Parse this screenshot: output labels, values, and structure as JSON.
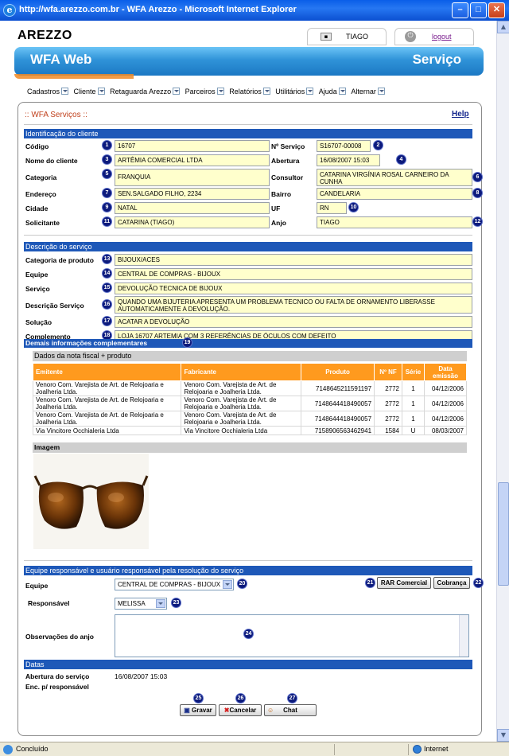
{
  "browser": {
    "title": "http://wfa.arezzo.com.br - WFA Arezzo - Microsoft Internet Explorer",
    "status_text": "Concluído",
    "zone": "Internet"
  },
  "header": {
    "logo": "AREZZO",
    "user": "TIAGO",
    "logout": "logout",
    "app_title": "WFA Web",
    "section_title": "Serviço"
  },
  "menu": [
    "Cadastros",
    "Cliente",
    "Retaguarda Arezzo",
    "Parceiros",
    "Relatórios",
    "Utilitários",
    "Ajuda",
    "Alternar"
  ],
  "page": {
    "title": ":: WFA Serviços ::",
    "help": "Help"
  },
  "client": {
    "section": "Identificação do cliente",
    "codigo_label": "Código",
    "codigo": "16707",
    "nservico_label": "Nº Serviço",
    "nservico": "S16707-00008",
    "nome_label": "Nome do cliente",
    "nome": "ARTÊMIA COMERCIAL LTDA",
    "abertura_label": "Abertura",
    "abertura": "16/08/2007 15:03",
    "categoria_label": "Categoria",
    "categoria": "FRANQUIA",
    "consultor_label": "Consultor",
    "consultor": "CATARINA VIRGÍNIA ROSAL CARNEIRO DA CUNHA",
    "endereco_label": "Endereço",
    "endereco": "SEN.SALGADO FILHO, 2234",
    "bairro_label": "Bairro",
    "bairro": "CANDELARIA",
    "cidade_label": "Cidade",
    "cidade": "NATAL",
    "uf_label": "UF",
    "uf": "RN",
    "solicitante_label": "Solicitante",
    "solicitante": "CATARINA (TIAGO)",
    "anjo_label": "Anjo",
    "anjo": "TIAGO"
  },
  "service": {
    "section": "Descrição do serviço",
    "categoria_label": "Categoria de produto",
    "categoria": "BIJOUX/ACES",
    "equipe_label": "Equipe",
    "equipe": "CENTRAL DE COMPRAS - BIJOUX",
    "servico_label": "Serviço",
    "servico": "DEVOLUÇÃO TECNICA DE BIJOUX",
    "descricao_label": "Descrição Serviço",
    "descricao": "QUANDO UMA BIJUTERIA APRESENTA UM PROBLEMA TECNICO OU FALTA DE ORNAMENTO LIBERASSE AUTOMATICAMENTE A DEVOLUÇÃO.",
    "solucao_label": "Solução",
    "solucao": "ACATAR A DEVOLUÇÃO",
    "complemento_label": "Complemento",
    "complemento": "LOJA 16707 ARTEMIA COM 3 REFERÊNCIAS DE ÓCULOS COM DEFEITO"
  },
  "extra": {
    "section": "Demais informações complementares",
    "nf_title": "Dados da nota fiscal + produto",
    "columns": [
      "Emitente",
      "Fabricante",
      "Produto",
      "Nº NF",
      "Série",
      "Data emissão"
    ],
    "rows": [
      [
        "Venoro Com. Varejista de Art. de Relojoaria e Joalheria Ltda.",
        "Venoro Com. Varejista de Art. de Relojoaria e Joalheria Ltda.",
        "7148645211591197",
        "2772",
        "1",
        "04/12/2006"
      ],
      [
        "Venoro Com. Varejista de Art. de Relojoaria e Joalheria Ltda.",
        "Venoro Com. Varejista de Art. de Relojoaria e Joalheria Ltda.",
        "7148644418490057",
        "2772",
        "1",
        "04/12/2006"
      ],
      [
        "Venoro Com. Varejista de Art. de Relojoaria e Joalheria Ltda.",
        "Venoro Com. Varejista de Art. de Relojoaria e Joalheria Ltda.",
        "7148644418490057",
        "2772",
        "1",
        "04/12/2006"
      ],
      [
        "Via Vincitore Occhialeria Ltda",
        "Via Vincitore Occhialeria Ltda",
        "7158906563462941",
        "1584",
        "U",
        "08/03/2007"
      ]
    ],
    "image_title": "Imagem"
  },
  "team": {
    "section": "Equipe responsável e usuário responsável pela resolução do serviço",
    "equipe_label": "Equipe",
    "equipe": "CENTRAL DE COMPRAS - BIJOUX",
    "rar_button": "RAR Comercial",
    "cobranca_button": "Cobrança",
    "responsavel_label": "Responsável",
    "responsavel": "MELISSA",
    "obs_label": "Observações do anjo"
  },
  "dates": {
    "section": "Datas",
    "abertura_label": "Abertura do serviço",
    "abertura": "16/08/2007 15:03",
    "enc_label": "Enc. p/ responsável"
  },
  "actions": {
    "gravar": "Gravar",
    "cancelar": "Cancelar",
    "chat": "Chat"
  },
  "markers": [
    "1",
    "2",
    "3",
    "4",
    "5",
    "6",
    "7",
    "8",
    "9",
    "10",
    "11",
    "12",
    "13",
    "14",
    "15",
    "16",
    "17",
    "18",
    "19",
    "20",
    "21",
    "22",
    "23",
    "24",
    "25",
    "26",
    "27"
  ],
  "colors": {
    "section_blue": "#1e58b8",
    "field_yellow": "#ffffcc",
    "table_orange": "#ff9a1e",
    "title_red": "#c0401c",
    "marker_navy": "#0c1a7c"
  }
}
